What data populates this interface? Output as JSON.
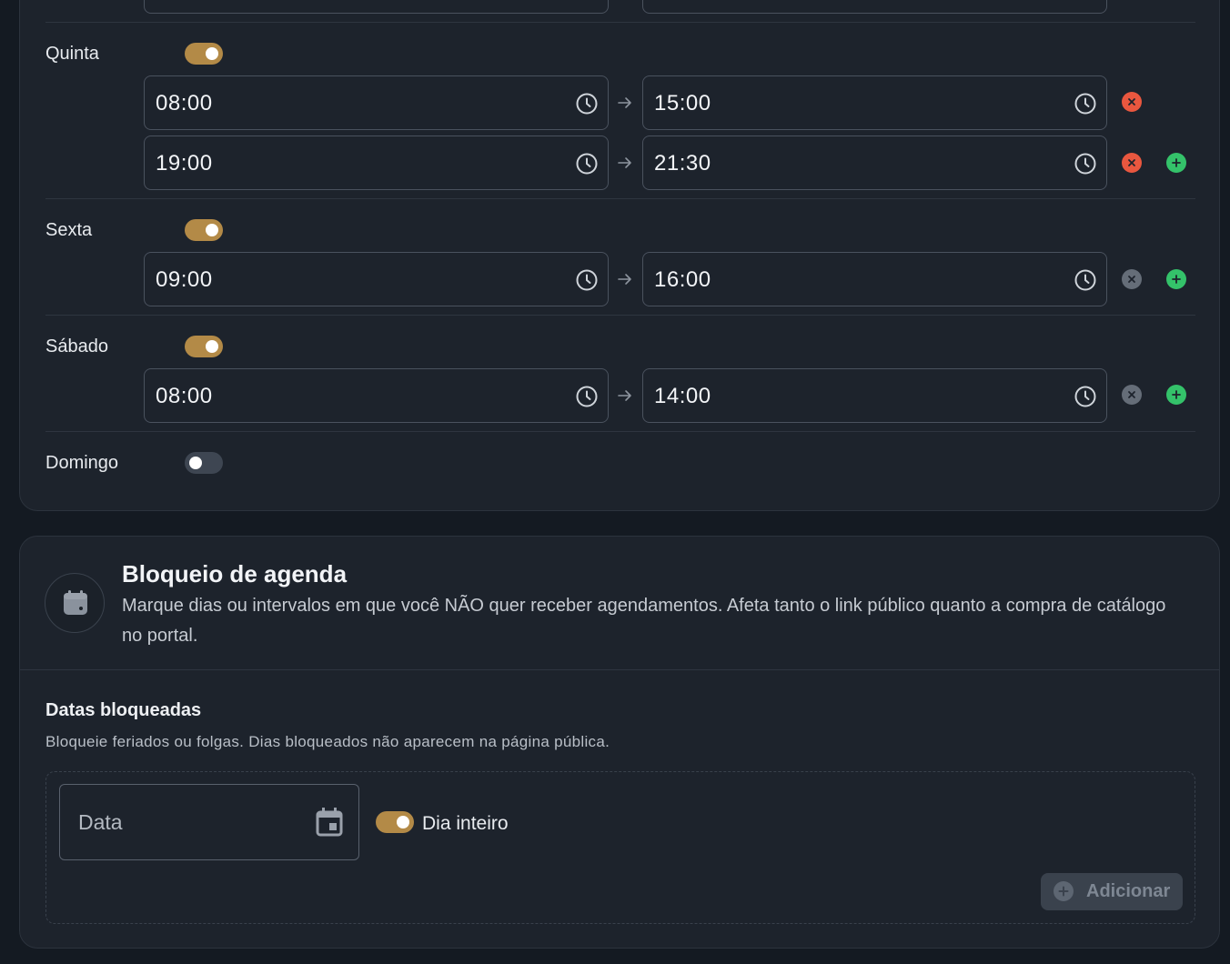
{
  "schedule": {
    "days": [
      {
        "name": "Quinta",
        "enabled": true,
        "slots": [
          {
            "start": "08:00",
            "end": "15:00",
            "remove_active": true,
            "show_add": false
          },
          {
            "start": "19:00",
            "end": "21:30",
            "remove_active": true,
            "show_add": true
          }
        ]
      },
      {
        "name": "Sexta",
        "enabled": true,
        "slots": [
          {
            "start": "09:00",
            "end": "16:00",
            "remove_active": false,
            "show_add": true
          }
        ]
      },
      {
        "name": "Sábado",
        "enabled": true,
        "slots": [
          {
            "start": "08:00",
            "end": "14:00",
            "remove_active": false,
            "show_add": true
          }
        ]
      },
      {
        "name": "Domingo",
        "enabled": false,
        "slots": []
      }
    ]
  },
  "block": {
    "title": "Bloqueio de agenda",
    "description": "Marque dias ou intervalos em que você NÃO quer receber agendamentos. Afeta tanto o link público quanto a compra de catálogo no portal.",
    "section_title": "Datas bloqueadas",
    "section_description": "Bloqueie feriados ou folgas. Dias bloqueados não aparecem na página pública.",
    "date_placeholder": "Data",
    "all_day_label": "Dia inteiro",
    "all_day_enabled": true,
    "add_label": "Adicionar"
  },
  "colors": {
    "accent": "#b38a47",
    "remove_active": "#e9573f",
    "remove_disabled": "#656d78",
    "add": "#34c26a"
  }
}
